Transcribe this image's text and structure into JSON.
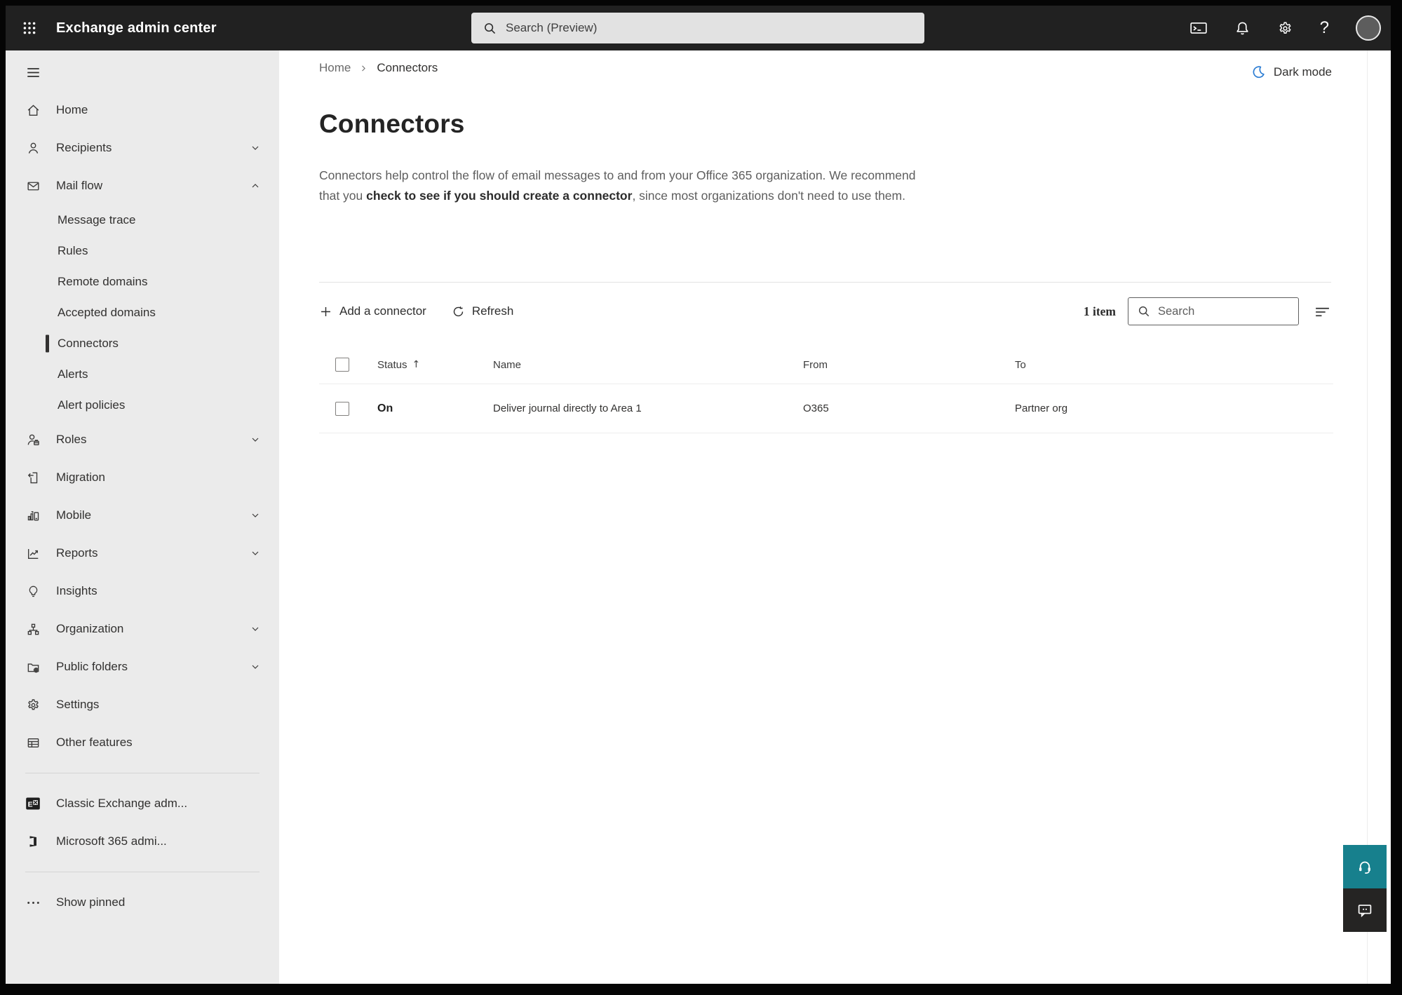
{
  "topbar": {
    "app_title": "Exchange admin center",
    "search_placeholder": "Search (Preview)"
  },
  "icons": {
    "help_glyph": "?",
    "sort_ascending_glyph": "↑"
  },
  "sidebar": {
    "items": [
      {
        "label": "Home"
      },
      {
        "label": "Recipients",
        "expandable": true
      },
      {
        "label": "Mail flow",
        "expandable": true,
        "expanded": true
      },
      {
        "label": "Message trace",
        "sub": true
      },
      {
        "label": "Rules",
        "sub": true
      },
      {
        "label": "Remote domains",
        "sub": true
      },
      {
        "label": "Accepted domains",
        "sub": true
      },
      {
        "label": "Connectors",
        "sub": true,
        "selected": true
      },
      {
        "label": "Alerts",
        "sub": true
      },
      {
        "label": "Alert policies",
        "sub": true
      },
      {
        "label": "Roles",
        "expandable": true
      },
      {
        "label": "Migration"
      },
      {
        "label": "Mobile",
        "expandable": true
      },
      {
        "label": "Reports",
        "expandable": true
      },
      {
        "label": "Insights"
      },
      {
        "label": "Organization",
        "expandable": true
      },
      {
        "label": "Public folders",
        "expandable": true
      },
      {
        "label": "Settings"
      },
      {
        "label": "Other features"
      }
    ],
    "footer_items": [
      {
        "label": "Classic Exchange adm..."
      },
      {
        "label": "Microsoft 365 admi..."
      }
    ],
    "show_pinned_label": "Show pinned"
  },
  "breadcrumb": {
    "home": "Home",
    "current": "Connectors"
  },
  "header_actions": {
    "dark_mode_label": "Dark mode"
  },
  "page": {
    "title": "Connectors",
    "description_prefix": "Connectors help control the flow of email messages to and from your Office 365 organization. We recommend that you ",
    "description_emphasis": "check to see if you should create a connector",
    "description_suffix": ", since most organizations don't need to use them."
  },
  "toolbar": {
    "add_label": "Add a connector",
    "refresh_label": "Refresh",
    "item_count": "1 item",
    "search_placeholder": "Search"
  },
  "table": {
    "headers": {
      "status": "Status",
      "name": "Name",
      "from": "From",
      "to": "To"
    },
    "rows": [
      {
        "status": "On",
        "name": "Deliver journal directly to Area 1",
        "from": "O365",
        "to": "Partner org"
      }
    ]
  },
  "colors": {
    "topbar_bg": "#212121",
    "sidebar_bg": "#ebebeb",
    "selected_indicator": "#323130",
    "dark_mode_blue": "#2b7cd3",
    "support_teal": "#17808d",
    "feedback_dark": "#252423"
  }
}
